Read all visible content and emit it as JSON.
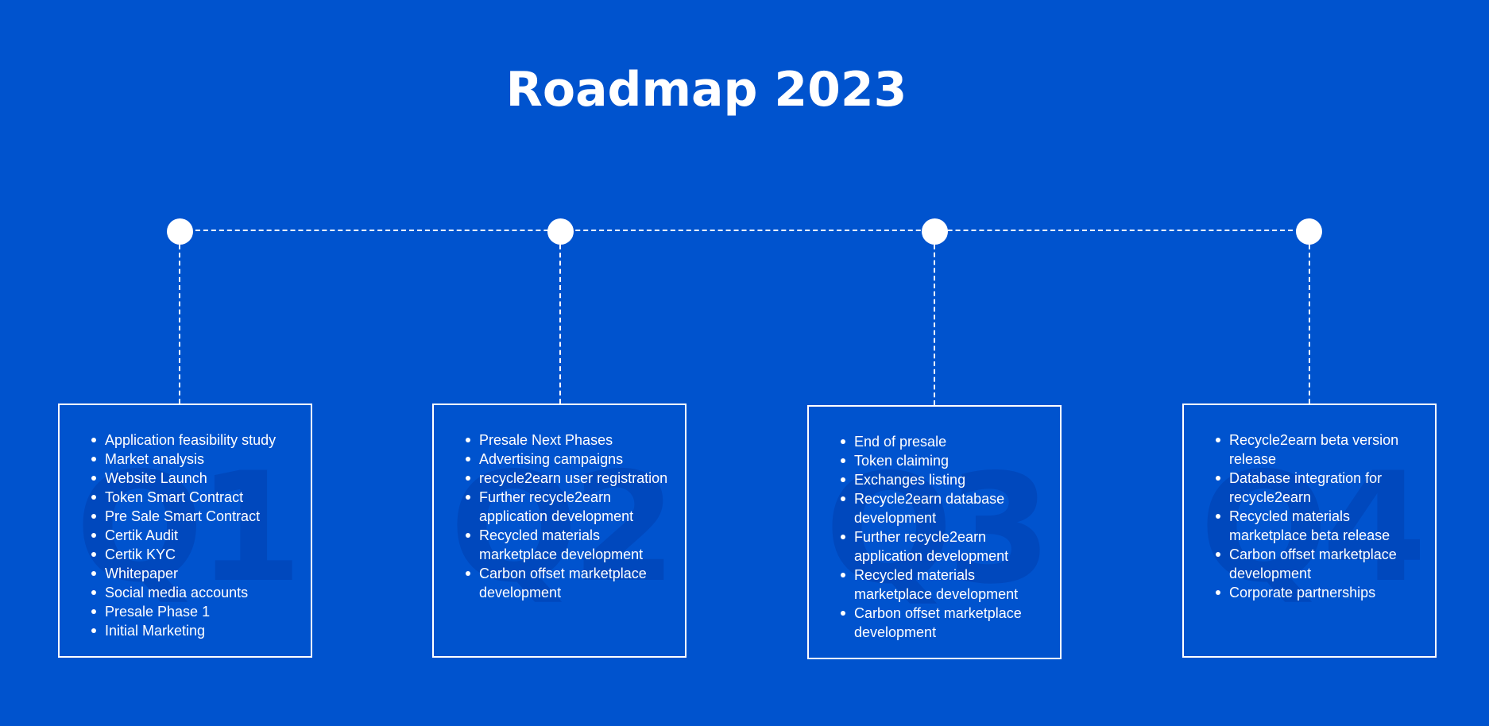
{
  "title": "Roadmap 2023",
  "colors": {
    "background": "#0053CE",
    "foreground": "#FFFFFF",
    "watermark": "#0048BD"
  },
  "quarters": [
    {
      "label": "Q1",
      "items": [
        "Application feasibility study",
        "Market analysis",
        "Website Launch",
        "Token Smart Contract",
        "Pre Sale Smart Contract",
        "Certik Audit",
        "Certik KYC",
        "Whitepaper",
        "Social media accounts",
        "Presale Phase 1",
        "Initial Marketing"
      ]
    },
    {
      "label": "Q2",
      "items": [
        "Presale Next Phases",
        "Advertising campaigns",
        "recycle2earn user registration",
        "Further recycle2earn application development",
        "Recycled materials marketplace development",
        "Carbon offset marketplace development"
      ]
    },
    {
      "label": "Q3",
      "items": [
        "End of presale",
        "Token claiming",
        "Exchanges listing",
        "Recycle2earn database development",
        "Further recycle2earn application development",
        "Recycled materials marketplace development",
        "Carbon offset marketplace development"
      ]
    },
    {
      "label": "Q4",
      "items": [
        "Recycle2earn beta version release",
        "Database integration for recycle2earn",
        "Recycled materials marketplace beta release",
        "Carbon offset marketplace development",
        "Corporate partnerships"
      ]
    }
  ]
}
